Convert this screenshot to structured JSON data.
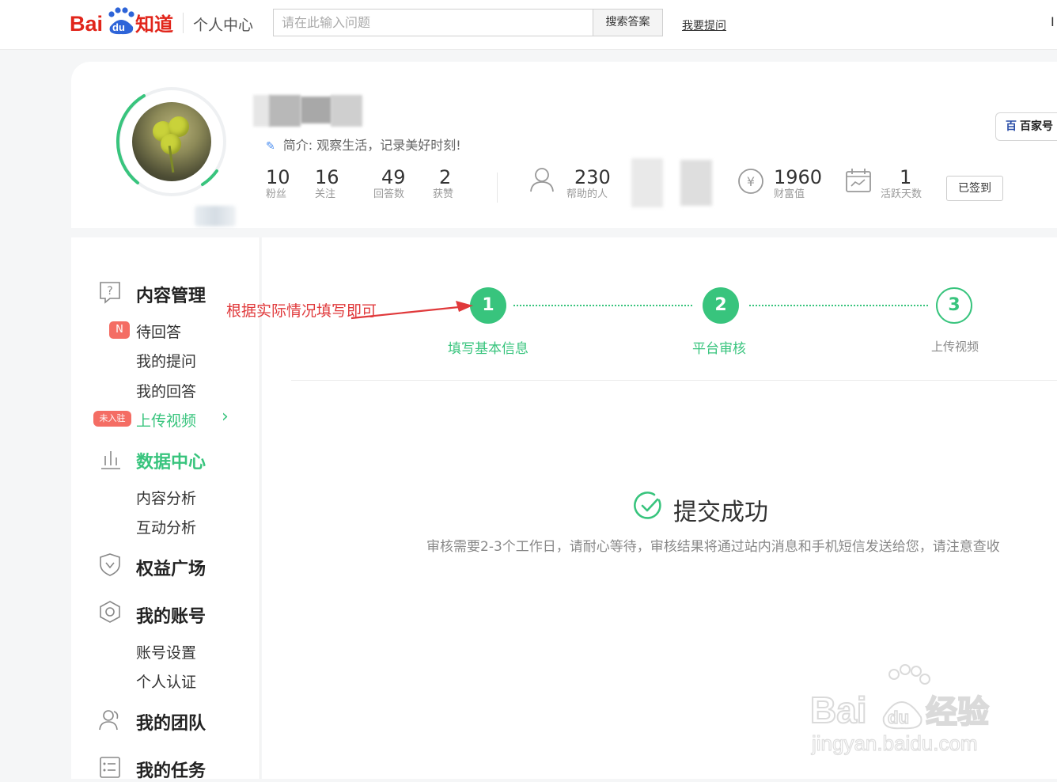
{
  "header": {
    "logo_text": "Bai du 知道",
    "center_title": "个人中心",
    "search_placeholder": "请在此输入问题",
    "search_button": "搜索答案",
    "ask_link": "我要提问",
    "right_glyph": "I"
  },
  "profile": {
    "intro_label": "简介: 观察生活，记录美好时刻!",
    "stats": [
      {
        "num": "10",
        "label": "粉丝"
      },
      {
        "num": "16",
        "label": "关注"
      },
      {
        "num": "49",
        "label": "回答数"
      },
      {
        "num": "2",
        "label": "获赞"
      }
    ],
    "helped": {
      "num": "230",
      "label": "帮助的人"
    },
    "wealth": {
      "num": "1960",
      "label": "财富值"
    },
    "active": {
      "num": "1",
      "label": "活跃天数"
    },
    "signed_button": "已签到",
    "baijiahao_label": "百家号"
  },
  "sidebar": {
    "content_mgmt": "内容管理",
    "badge_n": "N",
    "pending": "待回答",
    "my_questions": "我的提问",
    "my_answers": "我的回答",
    "badge_unjoined": "未入驻",
    "upload_video": "上传视频",
    "chevron": "›",
    "data_center": "数据中心",
    "content_analysis": "内容分析",
    "interaction_analysis": "互动分析",
    "benefits": "权益广场",
    "my_account": "我的账号",
    "account_settings": "账号设置",
    "personal_verify": "个人认证",
    "my_team": "我的团队",
    "my_tasks": "我的任务"
  },
  "steps": [
    {
      "num": "1",
      "label": "填写基本信息"
    },
    {
      "num": "2",
      "label": "平台审核"
    },
    {
      "num": "3",
      "label": "上传视频"
    }
  ],
  "success": {
    "title": "提交成功",
    "description": "审核需要2-3个工作日，请耐心等待，审核结果将通过站内消息和手机短信发送给您，请注意查收"
  },
  "annotation": "根据实际情况填写即可",
  "watermark": {
    "brand": "Bai du 经验",
    "url": "jingyan.baidu.com"
  },
  "colors": {
    "accent_green": "#38c47d",
    "baidu_red": "#e1251b",
    "baidu_blue": "#2e64d8",
    "annotation_red": "#e0393b"
  }
}
